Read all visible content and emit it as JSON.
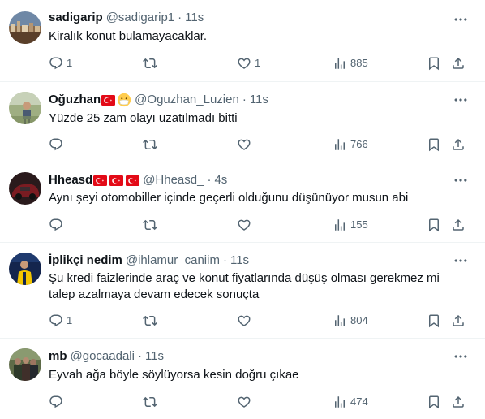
{
  "tweets": [
    {
      "name": "sadigarip",
      "handle": "@sadigarip1",
      "time": "11s",
      "text": "Kiralık konut bulamayacaklar.",
      "replies": "1",
      "likes": "1",
      "views": "885",
      "avatar": "city-skyline-avatar"
    },
    {
      "name": "Oğuzhan",
      "handle": "@Oguzhan_Luzien",
      "time": "11s",
      "text": "Yüzde 25 zam olayı uzatılmadı bitti",
      "replies": "",
      "likes": "",
      "views": "766",
      "avatar": "outdoor-person-avatar",
      "badges": [
        "turkey-flag-icon",
        "mask-face-emoji-icon"
      ]
    },
    {
      "name": "Hheasd",
      "handle": "@Hheasd_",
      "time": "4s",
      "text": "Aynı şeyi otomobiller içinde geçerli olduğunu düşünüyor musun abi",
      "replies": "",
      "likes": "",
      "views": "155",
      "avatar": "dark-red-car-avatar",
      "badges": [
        "turkey-flag-icon",
        "turkey-flag-icon",
        "turkey-flag-icon"
      ]
    },
    {
      "name": "İplikçi nedim",
      "handle": "@ihlamur_caniim",
      "time": "11s",
      "text": "Şu kredi faizlerinde araç ve konut fiyatlarında düşüş olması gerekmez mi talep azalmaya devam edecek sonuçta",
      "replies": "1",
      "likes": "",
      "views": "804",
      "avatar": "yellow-navy-football-avatar"
    },
    {
      "name": "mb",
      "handle": "@gocaadali",
      "time": "11s",
      "text": "Eyvah ağa böyle söylüyorsa kesin doğru çıkae",
      "replies": "",
      "likes": "",
      "views": "474",
      "avatar": "group-photo-avatar"
    }
  ],
  "colors": {
    "text_primary": "#0f1419",
    "text_secondary": "#536471",
    "divider": "#eff3f4",
    "flag_red": "#e30a17"
  },
  "icons": {
    "reply": "reply-icon",
    "retweet": "retweet-icon",
    "like": "heart-icon",
    "views": "views-bar-chart-icon",
    "bookmark": "bookmark-icon",
    "share": "share-icon",
    "more": "more-options-icon"
  }
}
